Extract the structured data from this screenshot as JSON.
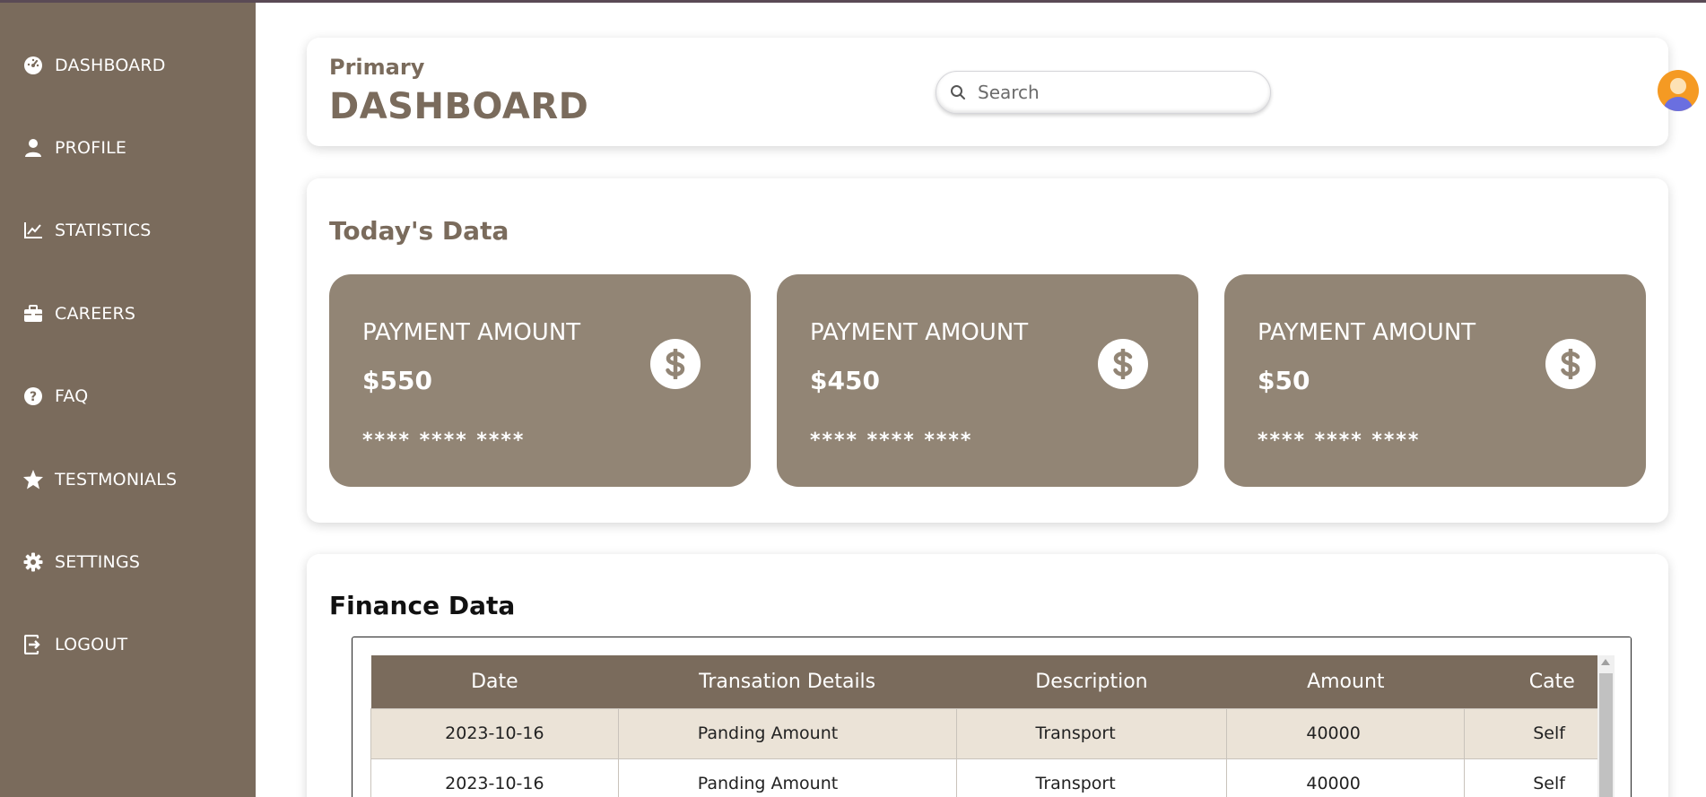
{
  "sidebar": {
    "items": [
      {
        "label": "DASHBOARD",
        "icon": "dashboard-gauge-icon"
      },
      {
        "label": "PROFILE",
        "icon": "user-icon"
      },
      {
        "label": "STATISTICS",
        "icon": "line-chart-icon"
      },
      {
        "label": "CAREERS",
        "icon": "briefcase-icon"
      },
      {
        "label": "FAQ",
        "icon": "question-circle-icon"
      },
      {
        "label": "TESTMONIALS",
        "icon": "star-icon"
      },
      {
        "label": "SETTINGS",
        "icon": "gear-icon"
      },
      {
        "label": "LOGOUT",
        "icon": "logout-icon"
      }
    ]
  },
  "header": {
    "subtitle": "Primary",
    "title": "DASHBOARD",
    "search_placeholder": "Search"
  },
  "today": {
    "title": "Today's Data",
    "cards": [
      {
        "label": "PAYMENT AMOUNT",
        "value": "$550",
        "mask": "**** **** ****"
      },
      {
        "label": "PAYMENT AMOUNT",
        "value": "$450",
        "mask": "**** **** ****"
      },
      {
        "label": "PAYMENT AMOUNT",
        "value": "$50",
        "mask": "**** **** ****"
      }
    ]
  },
  "finance": {
    "title": "Finance Data",
    "columns": [
      "Date",
      "Transation Details",
      "Description",
      "Amount",
      "Cate"
    ],
    "rows": [
      [
        "2023-10-16",
        "Panding Amount",
        "Transport",
        "40000",
        "Self"
      ],
      [
        "2023-10-16",
        "Panding Amount",
        "Transport",
        "40000",
        "Self"
      ]
    ]
  },
  "colors": {
    "sidebar_bg": "#7a6b5c",
    "card_bg": "#928575",
    "row_alt": "#ebe3d7"
  }
}
